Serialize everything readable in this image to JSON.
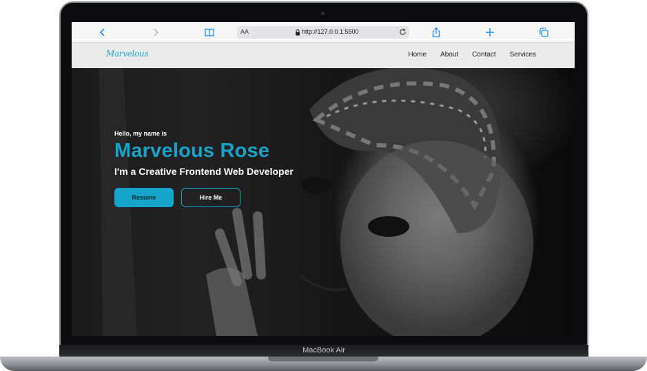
{
  "device": {
    "label": "MacBook Air"
  },
  "browser": {
    "text_size_label": "AA",
    "url": "http://127.0.0.1:5500",
    "icons": [
      "back-icon",
      "forward-icon",
      "bookmarks-icon",
      "text-size-icon",
      "lock-icon",
      "reload-icon",
      "share-icon",
      "new-tab-icon",
      "tabs-icon"
    ],
    "accent": "#1e8cf5"
  },
  "site": {
    "logo": "Marvelous",
    "nav": [
      {
        "label": "Home"
      },
      {
        "label": "About"
      },
      {
        "label": "Contact"
      },
      {
        "label": "Services"
      }
    ],
    "hero": {
      "greeting": "Hello, my name is",
      "name": "Marvelous Rose",
      "role": "I'm a Creative Frontend Web Developer",
      "primary_button": "Resume",
      "secondary_button": "Hire Me",
      "image": "grayscale portrait photo"
    },
    "colors": {
      "accent": "#18a5cc",
      "nav_bg": "#ebebeb",
      "hero_bg": "#1a1a1a"
    }
  }
}
